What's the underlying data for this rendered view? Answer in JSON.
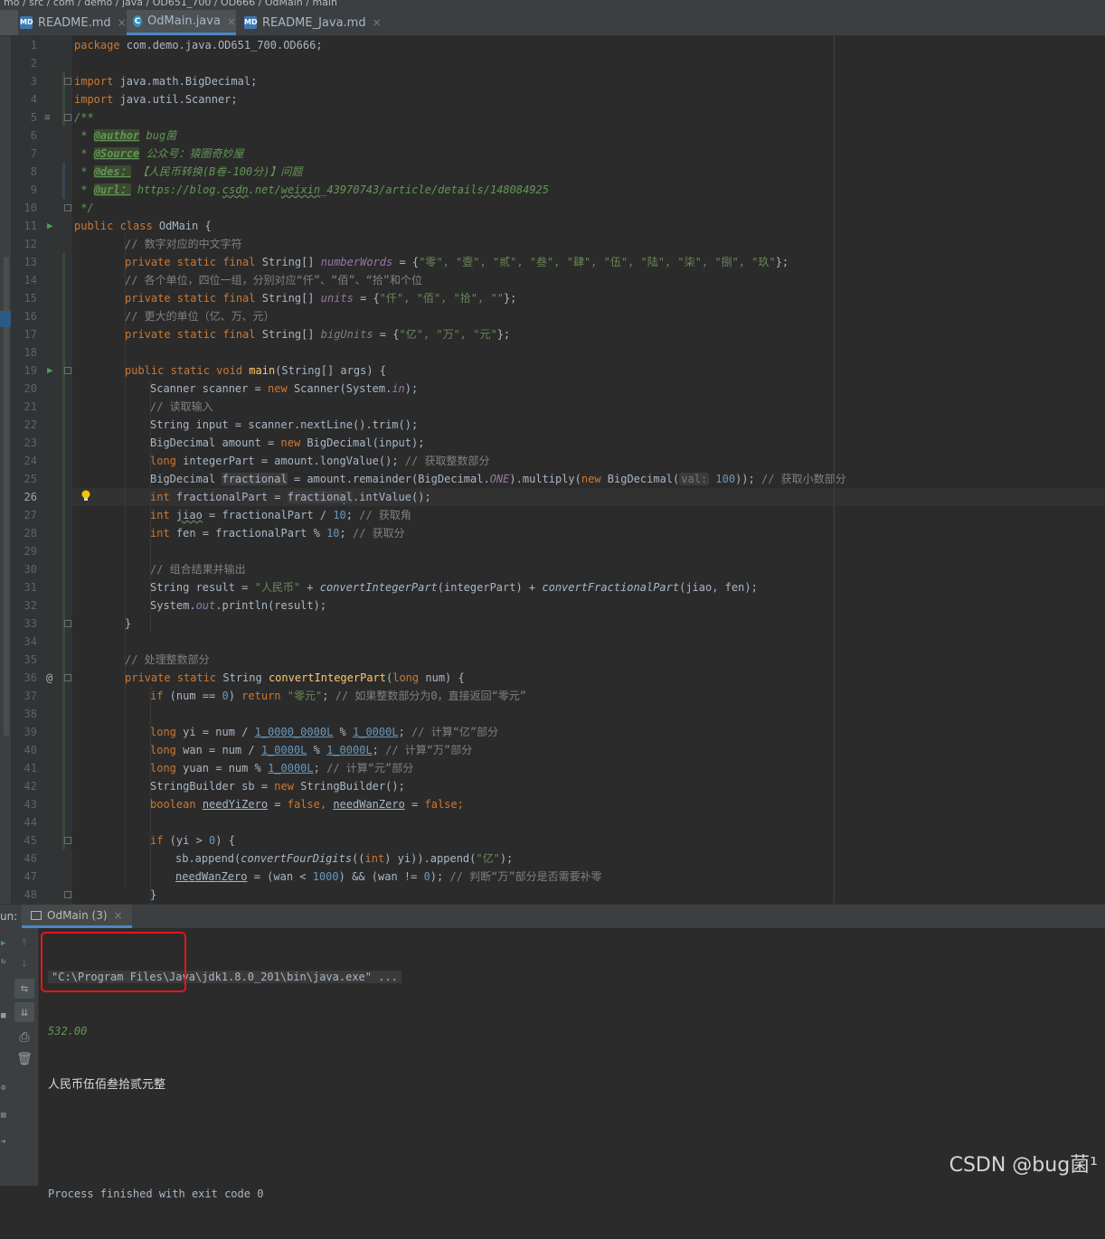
{
  "breadcrumb": "mo / src / com / demo / java / OD651_700 / OD666 / OdMain / main",
  "tabs": [
    {
      "label": "README.md",
      "icon": "md-file-icon"
    },
    {
      "label": "OdMain.java",
      "icon": "java-class-icon",
      "active": true
    },
    {
      "label": "README_Java.md",
      "icon": "md-file-icon"
    }
  ],
  "editor": {
    "current_line": 26,
    "line_numbers": [
      "1",
      "2",
      "3",
      "4",
      "5",
      "6",
      "7",
      "8",
      "9",
      "10",
      "11",
      "12",
      "13",
      "14",
      "15",
      "16",
      "17",
      "18",
      "19",
      "20",
      "21",
      "22",
      "23",
      "24",
      "25",
      "26",
      "27",
      "28",
      "29",
      "30",
      "31",
      "32",
      "33",
      "34",
      "35",
      "36",
      "37",
      "38",
      "39",
      "40",
      "41",
      "42",
      "43",
      "44",
      "45",
      "46",
      "47",
      "48"
    ],
    "code": {
      "l1_kw": "package",
      "l1_txt": " com.demo.java.OD651_700.OD666;",
      "l3_kw": "import",
      "l3_txt": " java.math.BigDecimal;",
      "l4_kw": "import",
      "l4_txt": " java.util.Scanner;",
      "l5": "/**",
      "l6_star": " * ",
      "l6_tag": "@author",
      "l6_val": " bug菌",
      "l7_star": " * ",
      "l7_tag": "@Source",
      "l7_val": " 公众号：猿圈奇妙屋",
      "l8_star": " * ",
      "l8_tag": "@des：",
      "l8_val": " 【人民币转换(B卷-100分)】问题",
      "l9_star": " * ",
      "l9_tag": "@url：",
      "l9_val1": " https://blog.",
      "l9_val2": "csdn",
      "l9_val3": ".net/",
      "l9_val4": "weixin",
      "l9_val5": "_43970743/article/details/148084925",
      "l10": " */",
      "l11_kw": "public class",
      "l11_txt": " OdMain {",
      "l12": "// 数字对应的中文字符",
      "l13_kw": "private static final",
      "l13_t1": " String[] ",
      "l13_field": "numberWords",
      "l13_t2": " = {",
      "l13_vals": "\"零\", \"壹\", \"贰\", \"叁\", \"肆\", \"伍\", \"陆\", \"柒\", \"捌\", \"玖\"",
      "l13_end": "};",
      "l14": "// 各个单位，四位一组，分别对应“仟”、“佰”、“拾”和个位",
      "l15_kw": "private static final",
      "l15_t1": " String[] ",
      "l15_field": "units",
      "l15_t2": " = {",
      "l15_vals": "\"仟\", \"佰\", \"拾\", \"\"",
      "l15_end": "};",
      "l16": "// 更大的单位（亿、万、元）",
      "l17_kw": "private static final",
      "l17_t1": " String[] ",
      "l17_field": "bigUnits",
      "l17_t2": " = {",
      "l17_vals": "\"亿\", \"万\", \"元\"",
      "l17_end": "};",
      "l19_kw": "public static void",
      "l19_fn": " main",
      "l19_txt": "(String[] args) {",
      "l20_t1": "Scanner scanner = ",
      "l20_kw": "new",
      "l20_t2": " Scanner(System.",
      "l20_f": "in",
      "l20_t3": ");",
      "l21": "// 读取输入",
      "l22": "String input = scanner.nextLine().trim();",
      "l23_t1": "BigDecimal amount = ",
      "l23_kw": "new",
      "l23_t2": " BigDecimal(input);",
      "l24_kw": "long",
      "l24_t1": " integerPart = amount.longValue(); ",
      "l24_c": "// 获取整数部分",
      "l25_t1": "BigDecimal ",
      "l25_var": "fractional",
      "l25_t2": " = amount.remainder(BigDecimal.",
      "l25_f": "ONE",
      "l25_t3": ").multiply(",
      "l25_kw": "new",
      "l25_t4": " BigDecimal(",
      "l25_hint": "val:",
      "l25_n": " 100",
      "l25_t5": ")); ",
      "l25_c": "// 获取小数部分",
      "l26_kw": "int",
      "l26_t1": " fractionalPart = ",
      "l26_var": "fractional",
      "l26_t2": ".intValue();",
      "l27_kw": "int",
      "l27_t1": " ",
      "l27_var": "jiao",
      "l27_t2": " = fractionalPart / ",
      "l27_n": "10",
      "l27_t3": "; ",
      "l27_c": "// 获取角",
      "l28_kw": "int",
      "l28_t1": " fen = fractionalPart % ",
      "l28_n": "10",
      "l28_t2": "; ",
      "l28_c": "// 获取分",
      "l30": "// 组合结果并输出",
      "l31_t1": "String result = ",
      "l31_s": "\"人民币\"",
      "l31_t2": " + ",
      "l31_m1": "convertIntegerPart",
      "l31_t3": "(integerPart) + ",
      "l31_m2": "convertFractionalPart",
      "l31_t4": "(jiao, fen);",
      "l32_t1": "System.",
      "l32_f": "out",
      "l32_t2": ".println(result);",
      "l33": "}",
      "l35": "// 处理整数部分",
      "l36_kw": "private static",
      "l36_t1": " String ",
      "l36_fn": "convertIntegerPart",
      "l36_t2": "(",
      "l36_kw2": "long",
      "l36_t3": " num) {",
      "l37_kw": "if",
      "l37_t1": " (num == ",
      "l37_n": "0",
      "l37_t2": ") ",
      "l37_kw2": "return",
      "l37_s": " \"零元\"",
      "l37_t3": "; ",
      "l37_c": "// 如果整数部分为0，直接返回“零元”",
      "l39_kw": "long",
      "l39_t1": " yi = num / ",
      "l39_n1": "1_0000_0000L",
      "l39_t2": " % ",
      "l39_n2": "1_0000L",
      "l39_t3": "; ",
      "l39_c": "// 计算“亿”部分",
      "l40_kw": "long",
      "l40_t1": " wan = num / ",
      "l40_n1": "1_0000L",
      "l40_t2": " % ",
      "l40_n2": "1_0000L",
      "l40_t3": "; ",
      "l40_c": "// 计算“万”部分",
      "l41_kw": "long",
      "l41_t1": " yuan = num % ",
      "l41_n": "1_0000L",
      "l41_t2": "; ",
      "l41_c": "// 计算“元”部分",
      "l42_t1": "StringBuilder sb = ",
      "l42_kw": "new",
      "l42_t2": " StringBuilder();",
      "l43_kw": "boolean",
      "l43_t1": " ",
      "l43_v1": "needYiZero",
      "l43_t2": " = ",
      "l43_kw2": "false",
      "l43_t3": ", ",
      "l43_v2": "needWanZero",
      "l43_t4": " = ",
      "l43_kw3": "false",
      "l43_t5": ";",
      "l45_kw": "if",
      "l45_t1": " (yi > ",
      "l45_n": "0",
      "l45_t2": ") {",
      "l46_t1": "sb.append(",
      "l46_m": "convertFourDigits",
      "l46_t2": "((",
      "l46_kw": "int",
      "l46_t3": ") yi)).append(",
      "l46_s": "\"亿\"",
      "l46_t4": ");",
      "l47_v": "needWanZero",
      "l47_t1": " = (wan < ",
      "l47_n1": "1000",
      "l47_t2": ") && (wan != ",
      "l47_n2": "0",
      "l47_t3": "); ",
      "l47_c": "// 判断“万”部分是否需要补零",
      "l48": "}"
    }
  },
  "run_panel": {
    "label": "un:",
    "tab_label": "OdMain (3)",
    "command": "\"C:\\Program Files\\Java\\jdk1.8.0_201\\bin\\java.exe\" ...",
    "input": "532.00",
    "output": "人民币伍佰叁拾贰元整",
    "exit": "Process finished with exit code 0"
  },
  "watermark": "CSDN @bug菌¹",
  "colors": {
    "keyword": "#cc7832",
    "string": "#6a8759",
    "comment": "#808080",
    "number": "#6897bb",
    "field": "#9876aa",
    "function": "#ffc66d",
    "highlight_box": "#e3161b"
  }
}
